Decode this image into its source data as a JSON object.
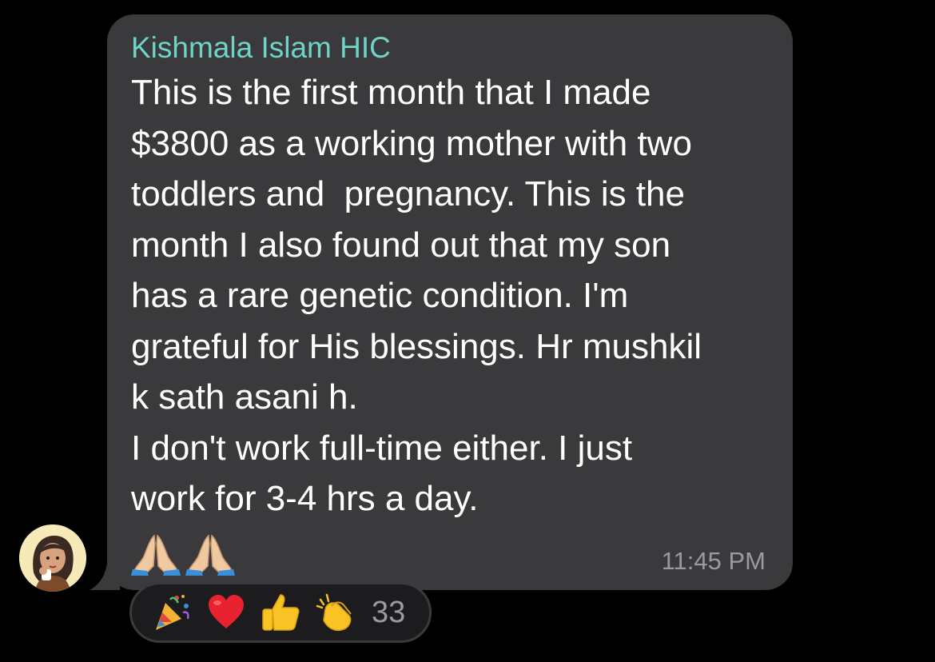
{
  "message": {
    "sender": "Kishmala Islam HIC",
    "lines": [
      "This is the first month that I made",
      "$3800 as a working mother with two",
      "toddlers and  pregnancy. This is the",
      "month I also found out that my son",
      "has a rare genetic condition. I'm",
      "grateful for His blessings. Hr mushkil",
      "k sath asani h.",
      "I don't work full-time either. I just",
      "work for 3-4 hrs a day."
    ],
    "trailing_emojis": [
      "folded-hands-icon",
      "folded-hands-icon"
    ],
    "timestamp": "11:45 PM"
  },
  "reactions": {
    "icons": [
      "party-popper-icon",
      "red-heart-icon",
      "thumbs-up-icon",
      "clapping-hands-icon"
    ],
    "count": "33"
  },
  "colors": {
    "background": "#000000",
    "bubble": "#3a3a3c",
    "sender": "#6fd3c7",
    "text": "#ffffff",
    "timestamp": "#9a9aa0"
  }
}
